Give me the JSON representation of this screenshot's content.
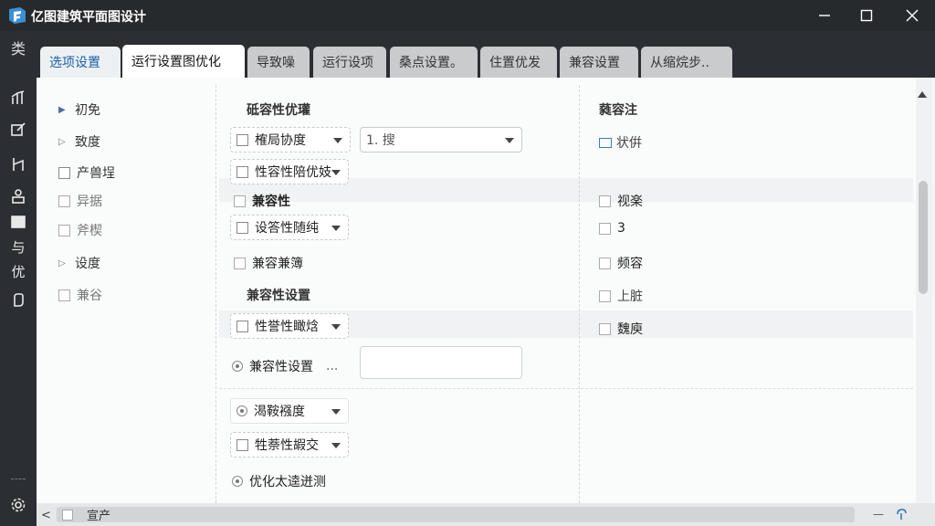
{
  "window": {
    "title": "亿图建筑平面图设计",
    "controls": [
      "minimize",
      "maximize",
      "close"
    ]
  },
  "left_sidebar": {
    "category_label": "类",
    "icons": [
      {
        "name": "chart-icon"
      },
      {
        "name": "edit-icon"
      },
      {
        "name": "measure-icon"
      },
      {
        "name": "user-icon"
      },
      {
        "name": "panel-icon"
      },
      {
        "name": "guide-icon",
        "text": "与"
      },
      {
        "name": "optimize-icon",
        "text": "优"
      },
      {
        "name": "hand-icon"
      }
    ],
    "settings_icon": "gear-icon"
  },
  "tabs": [
    {
      "label": "选项设置",
      "state": "selected"
    },
    {
      "label": "运行设置图优化",
      "state": "active"
    },
    {
      "label": "导致噪"
    },
    {
      "label": "运行设项"
    },
    {
      "label": "桑点设置。"
    },
    {
      "label": "住置优发"
    },
    {
      "label": "兼容设置"
    },
    {
      "label": "从缩烷步.."
    }
  ],
  "tree": [
    {
      "label": "初免",
      "kind": "expand"
    },
    {
      "label": "致度",
      "kind": "collapsed"
    },
    {
      "label": "产兽埕",
      "kind": "check"
    },
    {
      "label": "异据",
      "kind": "check",
      "dim": true
    },
    {
      "label": "斧楔",
      "kind": "check",
      "dim": true
    },
    {
      "label": "设度",
      "kind": "collapsed"
    },
    {
      "label": "兼谷",
      "kind": "check",
      "dim": true
    }
  ],
  "middle": {
    "heading1": "砥容性优瓘",
    "dropdown1": "榷局协度",
    "dropdown2": "1. 搜",
    "dropdown3": "性容性陪优妓",
    "label_compat": "兼容性",
    "dropdown4": "设答性随纯",
    "label_compat2": "兼容兼簿",
    "heading2": "兼容性设置",
    "dropdown5": "性誉性瞰焓",
    "radio1_label": "兼容性设置",
    "radio1_suffix": "...",
    "dropdown6": "渴鞍襁度",
    "dropdown7": "牲萘性嘏交",
    "radio2_label": "优化太逵迸测"
  },
  "right": {
    "heading": "蕤容注",
    "item_icon_label": "状倂",
    "checks": [
      "视楽",
      "3",
      "频容",
      "上脏",
      "魏庾"
    ]
  },
  "status_bar": {
    "scroll_left": "<",
    "label": "宣产"
  },
  "colors": {
    "titlebar": "#262a2d",
    "sidebar": "#2b2f33",
    "tab_inactive": "#c9cbcd",
    "tab_selected_text": "#1a5fa8",
    "panel": "#fafbfb"
  }
}
